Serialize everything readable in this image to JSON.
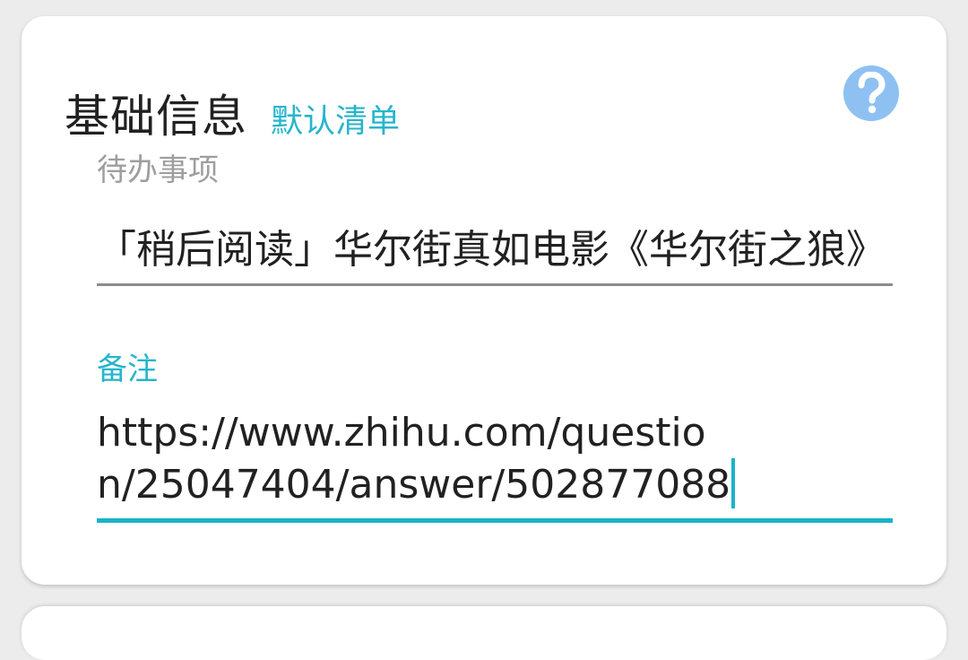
{
  "card": {
    "title": "基础信息",
    "list_link": "默认清单",
    "help_icon": "question-mark-icon"
  },
  "fields": {
    "todo": {
      "label": "待办事项",
      "value": "「稍后阅读」华尔街真如电影《华尔街之狼》"
    },
    "note": {
      "label": "备注",
      "value": "https://www.zhihu.com/question/25047404/answer/502877088"
    }
  },
  "colors": {
    "accent": "#19b3c9",
    "help_icon_bg": "#8ec1f2",
    "title_text": "#212121",
    "label_inactive": "#9e9e9e"
  }
}
